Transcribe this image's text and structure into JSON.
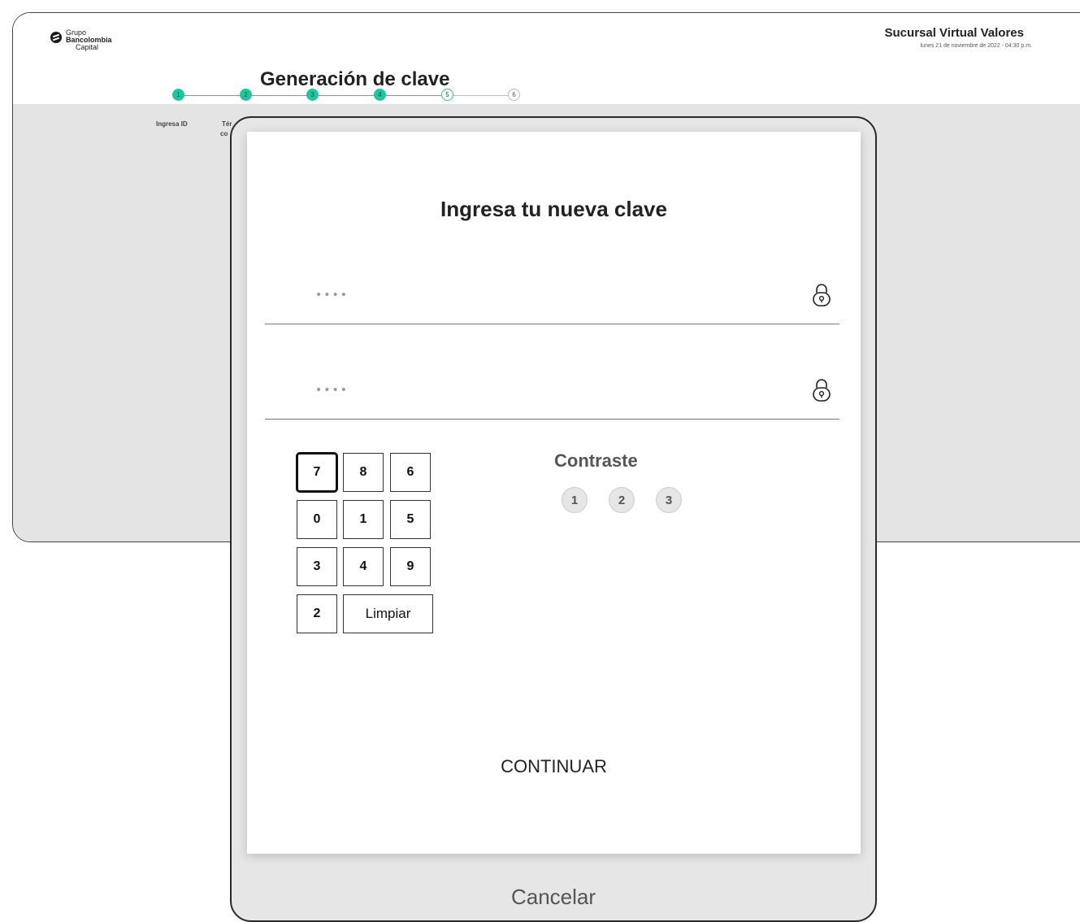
{
  "brand": {
    "logo_line1": "Grupo",
    "logo_line2": "Bancolombia",
    "logo_line3": "Capital",
    "title": "Sucursal Virtual Valores",
    "datetime": "lunes 21 de noviembre de 2022 - 04:30 p.m."
  },
  "page": {
    "title": "Generación de clave"
  },
  "stepper": {
    "steps": [
      {
        "number": "1",
        "state": "done"
      },
      {
        "number": "2",
        "state": "done"
      },
      {
        "number": "3",
        "state": "done"
      },
      {
        "number": "4",
        "state": "done"
      },
      {
        "number": "5",
        "state": "current"
      },
      {
        "number": "6",
        "state": "todo"
      }
    ],
    "labels": [
      "Ingresa ID",
      "Tér",
      "co"
    ]
  },
  "colors": {
    "accent": "#20c6a0",
    "modal_border": "#2a2a2a"
  },
  "modal": {
    "title": "Ingresa tu nueva clave",
    "password_placeholder": "••••",
    "confirm_placeholder": "••••",
    "lock_icon": "lock-icon",
    "keypad": {
      "keys": [
        "7",
        "8",
        "6",
        "0",
        "1",
        "5",
        "3",
        "4",
        "9",
        "2"
      ],
      "clear_label": "Limpiar"
    },
    "contrast": {
      "title": "Contraste",
      "options": [
        "1",
        "2",
        "3"
      ]
    },
    "continue_label": "CONTINUAR",
    "cancel_label": "Cancelar"
  }
}
